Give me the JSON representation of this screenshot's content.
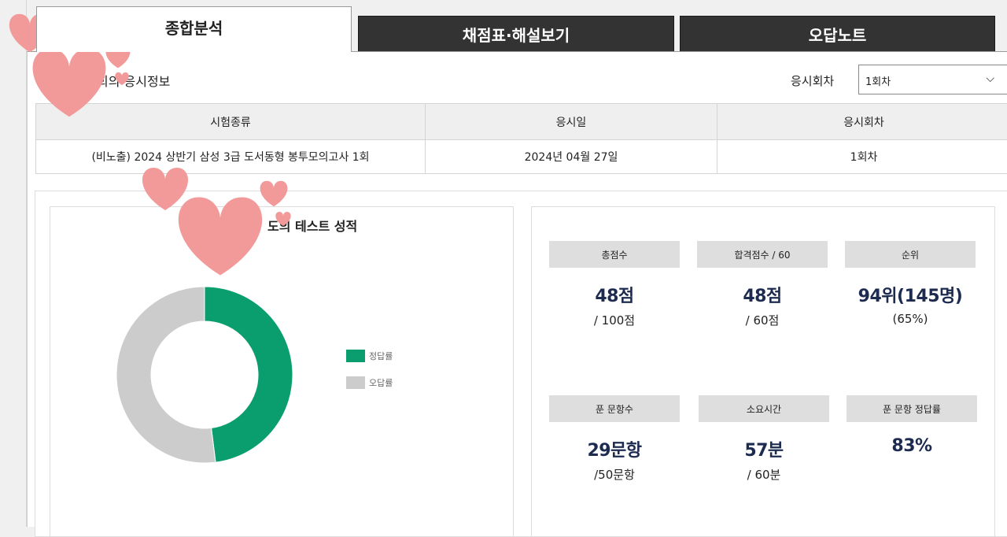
{
  "tabs": [
    {
      "label": "종합분석",
      "active": true
    },
    {
      "label": "채점표·해설보기",
      "active": false
    },
    {
      "label": "오답노트",
      "active": false
    }
  ],
  "section": {
    "title_visible": "회의 응시정보"
  },
  "round_selector": {
    "label": "응시회차",
    "value": "1회차"
  },
  "info_table": {
    "headers": [
      "시험종류",
      "응시일",
      "응시회차"
    ],
    "row": [
      "(비노출) 2024 상반기 삼성 3급 도서동형 봉투모의고사 1회",
      "2024년 04월 27일",
      "1회차"
    ]
  },
  "chart_panel": {
    "title_visible": "도의 테스트 성적"
  },
  "chart_data": {
    "type": "pie",
    "series": [
      {
        "name": "정답률",
        "value": 48,
        "color": "#0a9e6e"
      },
      {
        "name": "오답률",
        "value": 52,
        "color": "#cccccc"
      }
    ]
  },
  "stats": [
    {
      "label": "총점수",
      "value": "48점",
      "sub": "/ 100점"
    },
    {
      "label": "합격점수 / 60",
      "value": "48점",
      "sub": "/ 60점"
    },
    {
      "label": "순위",
      "value": "94위(145명)",
      "sub": "(65%)"
    },
    {
      "label": "푼 문항수",
      "value": "29문항",
      "sub": "/50문항"
    },
    {
      "label": "소요시간",
      "value": "57분",
      "sub": "/ 60분"
    },
    {
      "label": "푼 문항 정답률",
      "value": "83%",
      "sub": ""
    }
  ],
  "colors": {
    "correct": "#0a9e6e",
    "wrong": "#cccccc",
    "heart": "#f29a9a",
    "value_text": "#1c2b4f"
  }
}
